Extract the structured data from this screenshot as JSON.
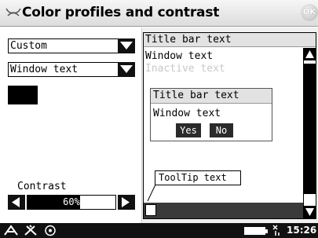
{
  "window": {
    "title": "Color profiles and contrast",
    "ok_label": "OK"
  },
  "left_panel": {
    "profile_select": {
      "value": "Custom"
    },
    "element_select": {
      "value": "Window text"
    },
    "color_swatch": "#000000",
    "contrast_label": "Contrast",
    "contrast_slider": {
      "value_text": "60%",
      "value": 0.6
    }
  },
  "preview": {
    "title_bar_text": "Title bar text",
    "window_text": "Window text",
    "inactive_text": "Inactive text",
    "dialog": {
      "title": "Title bar text",
      "text": "Window text",
      "yes_label": "Yes",
      "no_label": "No"
    },
    "tooltip_text": "ToolTip text"
  },
  "statusbar": {
    "clock": "15:26",
    "icons": [
      "start-icon",
      "tools-icon",
      "help-icon",
      "battery-icon",
      "signal-icon"
    ]
  },
  "colors": {
    "accent": "#000000",
    "background": "#ffffff",
    "title_gradient_top": "#f6f6f6",
    "statusbar": "#111111"
  }
}
